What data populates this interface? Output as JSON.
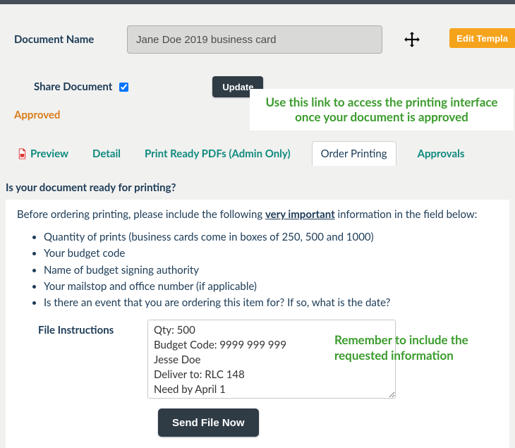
{
  "header": {
    "document_name_label": "Document Name",
    "document_name_value": "Jane Doe 2019 business card",
    "edit_template_label": "Edit Templa",
    "share_label": "Share Document",
    "share_checked": true,
    "update_label": "Update"
  },
  "status": {
    "approved_label": "Approved"
  },
  "annotations": {
    "top": "Use this link to access the printing interface once your document is approved",
    "side": "Remember to include the requested information"
  },
  "tabs": {
    "preview": "Preview",
    "detail": "Detail",
    "prpdfs": "Print Ready PDFs (Admin Only)",
    "order": "Order Printing",
    "approvals": "Approvals"
  },
  "panel": {
    "question": "Is your document ready for printing?",
    "intro_pre": "Before ordering printing, please include the following ",
    "intro_emph": "very important",
    "intro_post": " information in the field below:",
    "bullets": [
      "Quantity of prints (business cards come in boxes of 250, 500 and 1000)",
      "Your budget code",
      "Name of budget signing authority",
      "Your mailstop and office number (if applicable)",
      "Is there an event that you are ordering this item for? If so, what is the date?"
    ],
    "file_instructions_label": "File Instructions",
    "file_instructions_value": "Qty: 500\nBudget Code: 9999 999 999\nJesse Doe\nDeliver to: RLC 148\nNeed by April 1",
    "send_label": "Send File Now"
  }
}
